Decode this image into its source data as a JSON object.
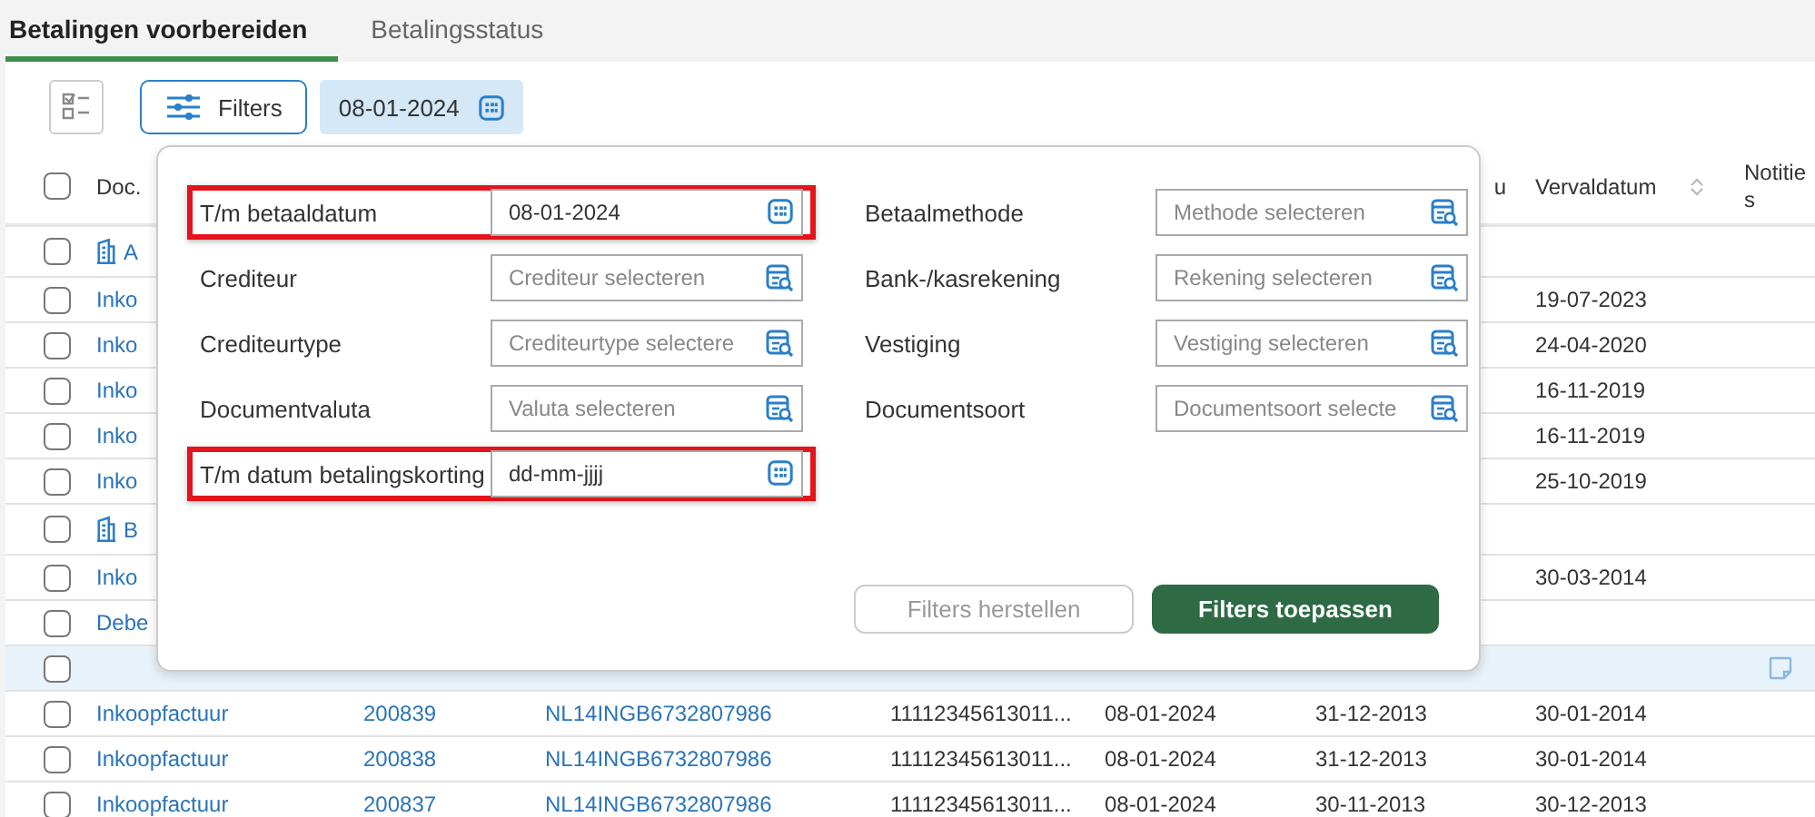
{
  "tabs": [
    {
      "label": "Betalingen voorbereiden",
      "selected": true
    },
    {
      "label": "Betalingsstatus",
      "selected": false
    }
  ],
  "toolbar": {
    "filters_button": "Filters",
    "date_chip": "08-01-2024"
  },
  "table": {
    "header": {
      "checked": false,
      "document_type": "Doc.",
      "column_6": "u",
      "vervaldatum": "Vervaldatum",
      "notities": "Notities"
    },
    "rows": [
      {
        "kind": "group",
        "checked": false,
        "selected": false,
        "label": "A"
      },
      {
        "kind": "doc",
        "checked": false,
        "selected": false,
        "document_type": "Inko",
        "vervaldatum": "19-07-2023"
      },
      {
        "kind": "doc",
        "checked": false,
        "selected": false,
        "document_type": "Inko",
        "vervaldatum": "24-04-2020"
      },
      {
        "kind": "doc",
        "checked": false,
        "selected": false,
        "document_type": "Inko",
        "vervaldatum": "16-11-2019"
      },
      {
        "kind": "doc",
        "checked": false,
        "selected": false,
        "document_type": "Inko",
        "vervaldatum": "16-11-2019"
      },
      {
        "kind": "doc",
        "checked": false,
        "selected": false,
        "document_type": "Inko",
        "vervaldatum": "25-10-2019"
      },
      {
        "kind": "group",
        "checked": false,
        "selected": false,
        "label": "B"
      },
      {
        "kind": "doc",
        "checked": false,
        "selected": false,
        "document_type": "Inko",
        "vervaldatum": "30-03-2014"
      },
      {
        "kind": "doc",
        "checked": false,
        "selected": false,
        "document_type": "Debe"
      },
      {
        "kind": "doc",
        "checked": false,
        "selected": true,
        "note": true
      },
      {
        "kind": "doc",
        "checked": false,
        "selected": false,
        "document_type": "Inkoopfactuur",
        "column_2": "200839",
        "column_3": "NL14INGB6732807986",
        "column_4": "11112345613011...",
        "column_5": "08-01-2024",
        "column_6": "31-12-2013",
        "vervaldatum": "30-01-2014"
      },
      {
        "kind": "doc",
        "checked": false,
        "selected": false,
        "document_type": "Inkoopfactuur",
        "column_2": "200838",
        "column_3": "NL14INGB6732807986",
        "column_4": "11112345613011...",
        "column_5": "08-01-2024",
        "column_6": "31-12-2013",
        "vervaldatum": "30-01-2014"
      },
      {
        "kind": "doc",
        "checked": false,
        "selected": false,
        "document_type": "Inkoopfactuur",
        "column_2": "200837",
        "column_3": "NL14INGB6732807986",
        "column_4": "11112345613011...",
        "column_5": "08-01-2024",
        "column_6": "30-11-2013",
        "vervaldatum": "30-12-2013"
      }
    ]
  },
  "filter_panel": {
    "left_fields": [
      {
        "kind": "date",
        "label": "T/m betaaldatum",
        "value": "08-01-2024",
        "highlighted": true
      },
      {
        "kind": "lookup",
        "label": "Crediteur",
        "placeholder": "Crediteur selecteren",
        "highlighted": false
      },
      {
        "kind": "lookup",
        "label": "Crediteurtype",
        "placeholder": "Crediteurtype selectere",
        "highlighted": false
      },
      {
        "kind": "lookup",
        "label": "Documentvaluta",
        "placeholder": "Valuta selecteren",
        "highlighted": false
      },
      {
        "kind": "date",
        "label": "T/m datum betalingskorting",
        "value": "dd-mm-jjjj",
        "highlighted": true
      }
    ],
    "right_fields": [
      {
        "kind": "lookup",
        "label": "Betaalmethode",
        "placeholder": "Methode selecteren",
        "highlighted": false
      },
      {
        "kind": "lookup",
        "label": "Bank-/kasrekening",
        "placeholder": "Rekening selecteren",
        "highlighted": false
      },
      {
        "kind": "lookup",
        "label": "Vestiging",
        "placeholder": "Vestiging selecteren",
        "highlighted": false
      },
      {
        "kind": "lookup",
        "label": "Documentsoort",
        "placeholder": "Documentsoort selecte",
        "highlighted": false
      }
    ],
    "buttons": [
      {
        "label": "Filters herstellen",
        "disabled": true
      },
      {
        "label": "Filters toepassen",
        "disabled": false
      }
    ]
  }
}
